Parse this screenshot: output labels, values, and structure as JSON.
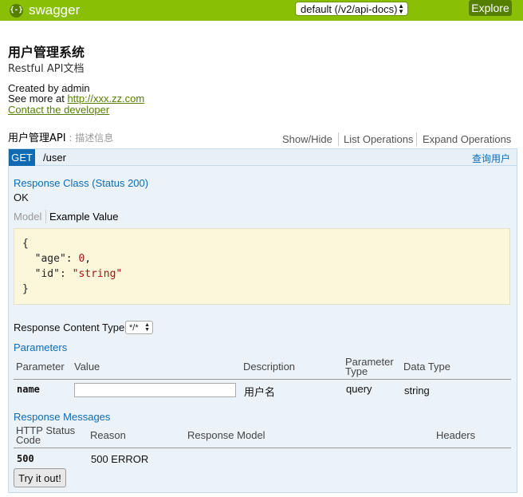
{
  "header": {
    "brand": "swagger",
    "logo_glyph": "{-}",
    "api_select_value": "default (/v2/api-docs)",
    "explore_label": "Explore",
    "color": "#89bf04"
  },
  "info": {
    "title": "用户管理系统",
    "subtitle": "Restful API文档",
    "created_by": "Created by admin",
    "see_more_prefix": "See more at ",
    "see_more_link": "http://xxx.zz.com",
    "contact_link": "Contact the developer"
  },
  "resource": {
    "name": "用户管理API",
    "separator": " : ",
    "description": "描述信息",
    "ops": {
      "show_hide": "Show/Hide",
      "list_operations": "List Operations",
      "expand_operations": "Expand Operations"
    }
  },
  "operation": {
    "method": "GET",
    "method_color": "#0f6ab4",
    "path": "/user",
    "summary": "查询用户",
    "response_class_title": "Response Class (Status 200)",
    "response_class_value": "OK",
    "tab_model": "Model",
    "tab_example": "Example Value",
    "code": {
      "open": "{",
      "age_key": "\"age\"",
      "age_value": "0",
      "id_key": "\"id\"",
      "id_value": "\"string\"",
      "close": "}"
    },
    "content_type_label": "Response Content Type",
    "content_type_value": "*/*",
    "parameters_title": "Parameters",
    "param_headers": {
      "parameter": "Parameter",
      "value": "Value",
      "description": "Description",
      "parameter_type_1": "Parameter",
      "parameter_type_2": "Type",
      "data_type": "Data Type"
    },
    "params": [
      {
        "name": "name",
        "value": "",
        "description": "用户名",
        "type": "query",
        "data_type": "string"
      }
    ],
    "response_messages_title": "Response Messages",
    "resp_headers": {
      "status_1": "HTTP Status",
      "status_2": "Code",
      "reason": "Reason",
      "model": "Response Model",
      "headers": "Headers"
    },
    "responses": [
      {
        "code": "500",
        "reason": "500 ERROR"
      }
    ],
    "try_label": "Try it out!"
  }
}
